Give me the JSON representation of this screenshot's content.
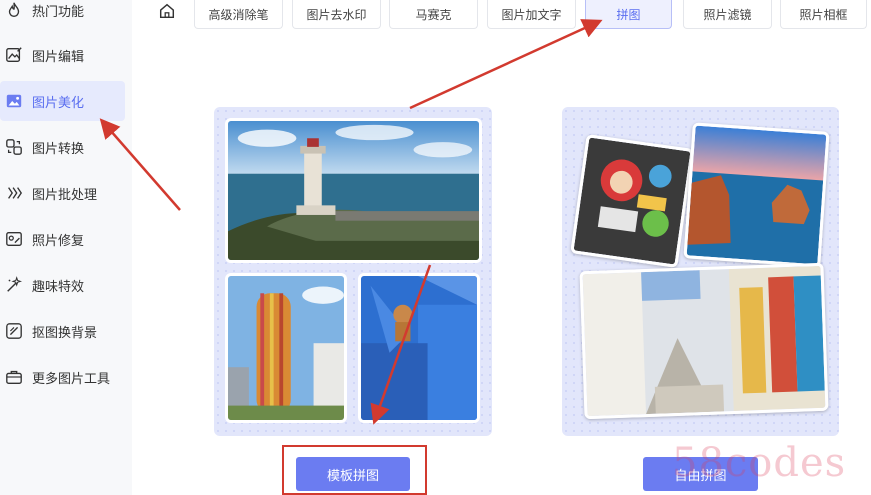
{
  "sidebar": {
    "items": [
      {
        "label": "热门功能",
        "icon": "flame-icon"
      },
      {
        "label": "图片编辑",
        "icon": "image-edit-icon"
      },
      {
        "label": "图片美化",
        "icon": "image-beautify-icon",
        "active": true
      },
      {
        "label": "图片转换",
        "icon": "convert-icon"
      },
      {
        "label": "图片批处理",
        "icon": "batch-icon"
      },
      {
        "label": "照片修复",
        "icon": "photo-repair-icon"
      },
      {
        "label": "趣味特效",
        "icon": "magic-wand-icon"
      },
      {
        "label": "抠图换背景",
        "icon": "cutout-icon"
      },
      {
        "label": "更多图片工具",
        "icon": "toolbox-icon"
      }
    ]
  },
  "tabs": [
    {
      "label": "高级消除笔"
    },
    {
      "label": "图片去水印"
    },
    {
      "label": "马赛克"
    },
    {
      "label": "图片加文字"
    },
    {
      "label": "拼图",
      "active": true
    },
    {
      "label": "照片滤镜"
    },
    {
      "label": "照片相框"
    }
  ],
  "cards": {
    "template_button": "模板拼图",
    "free_button": "自由拼图"
  },
  "watermark": "58codes",
  "colors": {
    "accent": "#6b7cf1",
    "active_bg": "#e6eafd",
    "card_bg": "#e2e6fb",
    "annotation_red": "#d23a2f"
  }
}
